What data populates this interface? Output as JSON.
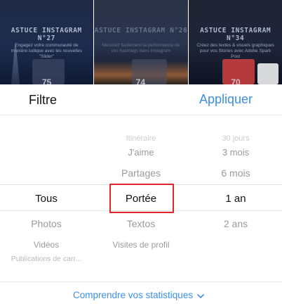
{
  "background_cards": [
    {
      "title": "ASTUCE INSTAGRAM N°27",
      "desc": "Engagez votre communauté de manière ludique avec les nouvelles \"Slider\"",
      "number": "75"
    },
    {
      "title": "ASTUCE INSTAGRAM N°26",
      "desc": "Mesurez facilement la performance de vos hashtags dans Instagram",
      "number": "74"
    },
    {
      "title": "ASTUCE INSTAGRAM N°34",
      "desc": "Créez des textes & visuels graphiques pour vos Stories avec Adobe Spark Post",
      "number": "70"
    }
  ],
  "sheet": {
    "title": "Filtre",
    "apply_label": "Appliquer"
  },
  "picker": {
    "left": {
      "items": [
        "Tous",
        "Photos",
        "Vidéos",
        "Publications de carr..."
      ],
      "selected": "Tous"
    },
    "middle": {
      "items": [
        "Itinéraire",
        "J'aime",
        "Partages",
        "Portée",
        "Textos",
        "Visites de profil"
      ],
      "selected": "Portée"
    },
    "right": {
      "items": [
        "30 jours",
        "3 mois",
        "6 mois",
        "1 an",
        "2 ans"
      ],
      "selected": "1 an"
    }
  },
  "footer": {
    "link_label": "Comprendre vos statistiques"
  },
  "colors": {
    "accent": "#3b8fe8",
    "highlight": "#e0262b",
    "muted_text": "#9b9b9f"
  }
}
